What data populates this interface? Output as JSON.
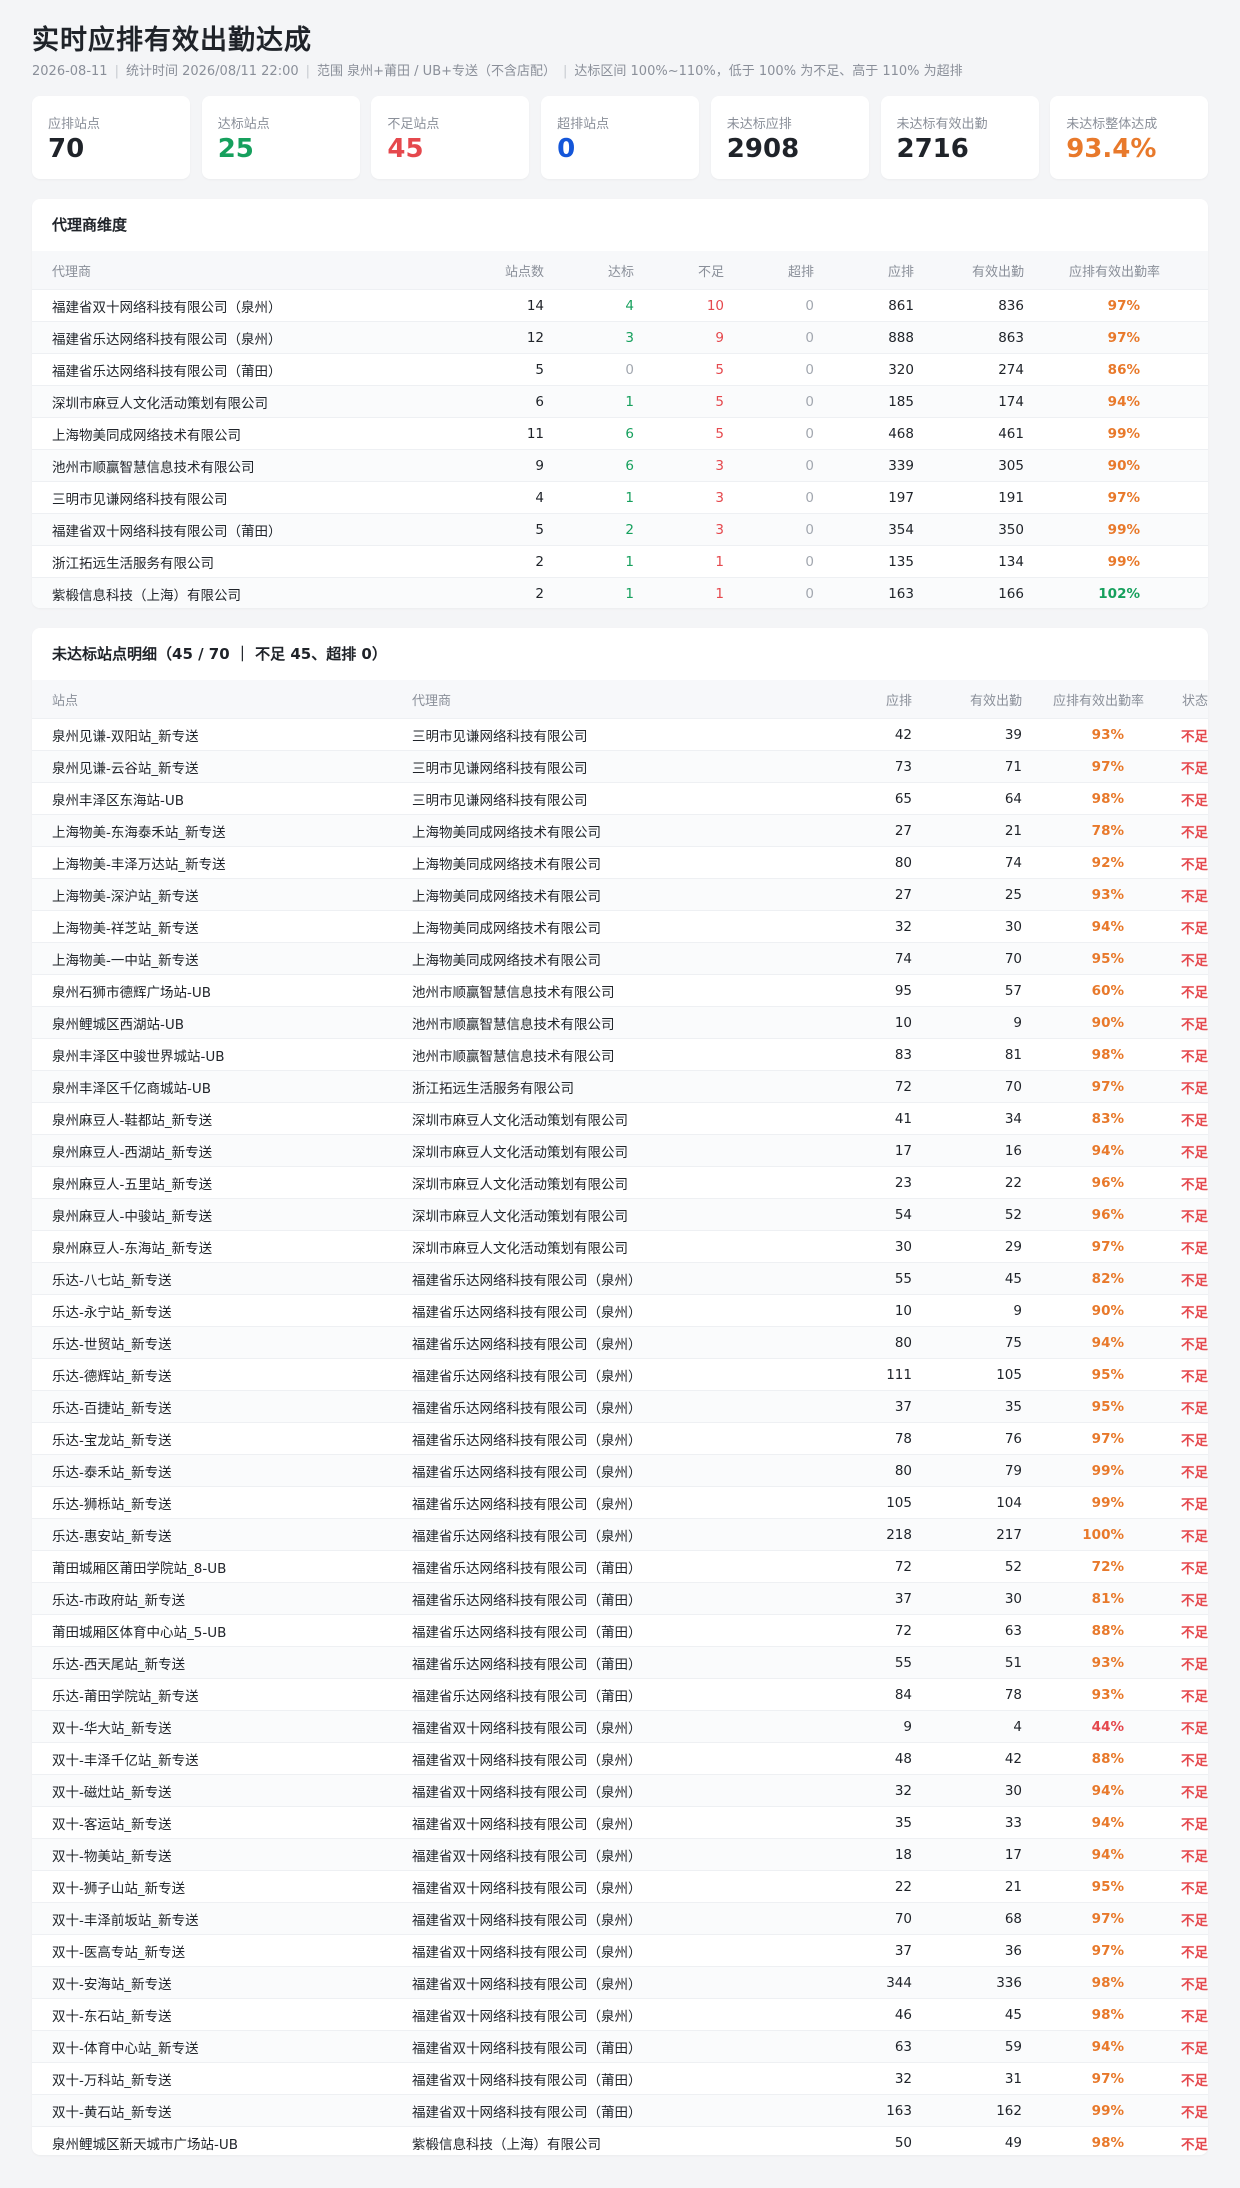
{
  "page": {
    "title": "实时应排有效出勤达成",
    "meta": [
      "2026-08-11",
      "统计时间 2026/08/11 22:00",
      "范围 泉州+莆田 / UB+专送（不含店配）",
      "达标区间 100%~110%，低于 100% 为不足、高于 110% 为超排"
    ]
  },
  "colors": {
    "green": "#16a05d",
    "red": "#e5484d",
    "orange": "#e8792b",
    "blue": "#1456d9",
    "gray": "#a3a8b0"
  },
  "kpis": [
    {
      "label": "应排站点",
      "value": "70",
      "color": "default"
    },
    {
      "label": "达标站点",
      "value": "25",
      "color": "green"
    },
    {
      "label": "不足站点",
      "value": "45",
      "color": "red"
    },
    {
      "label": "超排站点",
      "value": "0",
      "color": "blue"
    },
    {
      "label": "未达标应排",
      "value": "2908",
      "color": "default"
    },
    {
      "label": "未达标有效出勤",
      "value": "2716",
      "color": "default"
    },
    {
      "label": "未达标整体达成",
      "value": "93.4%",
      "color": "orange"
    }
  ],
  "agent_table": {
    "title": "代理商维度",
    "headers": [
      "代理商",
      "站点数",
      "达标",
      "不足",
      "超排",
      "应排",
      "有效出勤",
      "应排有效出勤率"
    ],
    "rows": [
      [
        "福建省双十网络科技有限公司（泉州）",
        "14",
        "4",
        "10",
        "0",
        "861",
        "836",
        "97%"
      ],
      [
        "福建省乐达网络科技有限公司（泉州）",
        "12",
        "3",
        "9",
        "0",
        "888",
        "863",
        "97%"
      ],
      [
        "福建省乐达网络科技有限公司（莆田）",
        "5",
        "0",
        "5",
        "0",
        "320",
        "274",
        "86%"
      ],
      [
        "深圳市麻豆人文化活动策划有限公司",
        "6",
        "1",
        "5",
        "0",
        "185",
        "174",
        "94%"
      ],
      [
        "上海物美同成网络技术有限公司",
        "11",
        "6",
        "5",
        "0",
        "468",
        "461",
        "99%"
      ],
      [
        "池州市顺赢智慧信息技术有限公司",
        "9",
        "6",
        "3",
        "0",
        "339",
        "305",
        "90%"
      ],
      [
        "三明市见谦网络科技有限公司",
        "4",
        "1",
        "3",
        "0",
        "197",
        "191",
        "97%"
      ],
      [
        "福建省双十网络科技有限公司（莆田）",
        "5",
        "2",
        "3",
        "0",
        "354",
        "350",
        "99%"
      ],
      [
        "浙江拓远生活服务有限公司",
        "2",
        "1",
        "1",
        "0",
        "135",
        "134",
        "99%"
      ],
      [
        "紫椴信息科技（上海）有限公司",
        "2",
        "1",
        "1",
        "0",
        "163",
        "166",
        "102%"
      ]
    ]
  },
  "station_table": {
    "title": "未达标站点明细（45 / 70 ｜ 不足 45、超排 0）",
    "headers": [
      "站点",
      "代理商",
      "应排",
      "有效出勤",
      "应排有效出勤率",
      "状态"
    ],
    "rows": [
      [
        "泉州见谦-双阳站_新专送",
        "三明市见谦网络科技有限公司",
        "42",
        "39",
        "93%",
        "不足"
      ],
      [
        "泉州见谦-云谷站_新专送",
        "三明市见谦网络科技有限公司",
        "73",
        "71",
        "97%",
        "不足"
      ],
      [
        "泉州丰泽区东海站-UB",
        "三明市见谦网络科技有限公司",
        "65",
        "64",
        "98%",
        "不足"
      ],
      [
        "上海物美-东海泰禾站_新专送",
        "上海物美同成网络技术有限公司",
        "27",
        "21",
        "78%",
        "不足"
      ],
      [
        "上海物美-丰泽万达站_新专送",
        "上海物美同成网络技术有限公司",
        "80",
        "74",
        "92%",
        "不足"
      ],
      [
        "上海物美-深沪站_新专送",
        "上海物美同成网络技术有限公司",
        "27",
        "25",
        "93%",
        "不足"
      ],
      [
        "上海物美-祥芝站_新专送",
        "上海物美同成网络技术有限公司",
        "32",
        "30",
        "94%",
        "不足"
      ],
      [
        "上海物美-一中站_新专送",
        "上海物美同成网络技术有限公司",
        "74",
        "70",
        "95%",
        "不足"
      ],
      [
        "泉州石狮市德辉广场站-UB",
        "池州市顺赢智慧信息技术有限公司",
        "95",
        "57",
        "60%",
        "不足"
      ],
      [
        "泉州鲤城区西湖站-UB",
        "池州市顺赢智慧信息技术有限公司",
        "10",
        "9",
        "90%",
        "不足"
      ],
      [
        "泉州丰泽区中骏世界城站-UB",
        "池州市顺赢智慧信息技术有限公司",
        "83",
        "81",
        "98%",
        "不足"
      ],
      [
        "泉州丰泽区千亿商城站-UB",
        "浙江拓远生活服务有限公司",
        "72",
        "70",
        "97%",
        "不足"
      ],
      [
        "泉州麻豆人-鞋都站_新专送",
        "深圳市麻豆人文化活动策划有限公司",
        "41",
        "34",
        "83%",
        "不足"
      ],
      [
        "泉州麻豆人-西湖站_新专送",
        "深圳市麻豆人文化活动策划有限公司",
        "17",
        "16",
        "94%",
        "不足"
      ],
      [
        "泉州麻豆人-五里站_新专送",
        "深圳市麻豆人文化活动策划有限公司",
        "23",
        "22",
        "96%",
        "不足"
      ],
      [
        "泉州麻豆人-中骏站_新专送",
        "深圳市麻豆人文化活动策划有限公司",
        "54",
        "52",
        "96%",
        "不足"
      ],
      [
        "泉州麻豆人-东海站_新专送",
        "深圳市麻豆人文化活动策划有限公司",
        "30",
        "29",
        "97%",
        "不足"
      ],
      [
        "乐达-八七站_新专送",
        "福建省乐达网络科技有限公司（泉州）",
        "55",
        "45",
        "82%",
        "不足"
      ],
      [
        "乐达-永宁站_新专送",
        "福建省乐达网络科技有限公司（泉州）",
        "10",
        "9",
        "90%",
        "不足"
      ],
      [
        "乐达-世贸站_新专送",
        "福建省乐达网络科技有限公司（泉州）",
        "80",
        "75",
        "94%",
        "不足"
      ],
      [
        "乐达-德辉站_新专送",
        "福建省乐达网络科技有限公司（泉州）",
        "111",
        "105",
        "95%",
        "不足"
      ],
      [
        "乐达-百捷站_新专送",
        "福建省乐达网络科技有限公司（泉州）",
        "37",
        "35",
        "95%",
        "不足"
      ],
      [
        "乐达-宝龙站_新专送",
        "福建省乐达网络科技有限公司（泉州）",
        "78",
        "76",
        "97%",
        "不足"
      ],
      [
        "乐达-泰禾站_新专送",
        "福建省乐达网络科技有限公司（泉州）",
        "80",
        "79",
        "99%",
        "不足"
      ],
      [
        "乐达-狮栎站_新专送",
        "福建省乐达网络科技有限公司（泉州）",
        "105",
        "104",
        "99%",
        "不足"
      ],
      [
        "乐达-惠安站_新专送",
        "福建省乐达网络科技有限公司（泉州）",
        "218",
        "217",
        "100%",
        "不足"
      ],
      [
        "莆田城厢区莆田学院站_8-UB",
        "福建省乐达网络科技有限公司（莆田）",
        "72",
        "52",
        "72%",
        "不足"
      ],
      [
        "乐达-市政府站_新专送",
        "福建省乐达网络科技有限公司（莆田）",
        "37",
        "30",
        "81%",
        "不足"
      ],
      [
        "莆田城厢区体育中心站_5-UB",
        "福建省乐达网络科技有限公司（莆田）",
        "72",
        "63",
        "88%",
        "不足"
      ],
      [
        "乐达-西天尾站_新专送",
        "福建省乐达网络科技有限公司（莆田）",
        "55",
        "51",
        "93%",
        "不足"
      ],
      [
        "乐达-莆田学院站_新专送",
        "福建省乐达网络科技有限公司（莆田）",
        "84",
        "78",
        "93%",
        "不足"
      ],
      [
        "双十-华大站_新专送",
        "福建省双十网络科技有限公司（泉州）",
        "9",
        "4",
        "44%",
        "不足"
      ],
      [
        "双十-丰泽千亿站_新专送",
        "福建省双十网络科技有限公司（泉州）",
        "48",
        "42",
        "88%",
        "不足"
      ],
      [
        "双十-磁灶站_新专送",
        "福建省双十网络科技有限公司（泉州）",
        "32",
        "30",
        "94%",
        "不足"
      ],
      [
        "双十-客运站_新专送",
        "福建省双十网络科技有限公司（泉州）",
        "35",
        "33",
        "94%",
        "不足"
      ],
      [
        "双十-物美站_新专送",
        "福建省双十网络科技有限公司（泉州）",
        "18",
        "17",
        "94%",
        "不足"
      ],
      [
        "双十-狮子山站_新专送",
        "福建省双十网络科技有限公司（泉州）",
        "22",
        "21",
        "95%",
        "不足"
      ],
      [
        "双十-丰泽前坂站_新专送",
        "福建省双十网络科技有限公司（泉州）",
        "70",
        "68",
        "97%",
        "不足"
      ],
      [
        "双十-医高专站_新专送",
        "福建省双十网络科技有限公司（泉州）",
        "37",
        "36",
        "97%",
        "不足"
      ],
      [
        "双十-安海站_新专送",
        "福建省双十网络科技有限公司（泉州）",
        "344",
        "336",
        "98%",
        "不足"
      ],
      [
        "双十-东石站_新专送",
        "福建省双十网络科技有限公司（泉州）",
        "46",
        "45",
        "98%",
        "不足"
      ],
      [
        "双十-体育中心站_新专送",
        "福建省双十网络科技有限公司（莆田）",
        "63",
        "59",
        "94%",
        "不足"
      ],
      [
        "双十-万科站_新专送",
        "福建省双十网络科技有限公司（莆田）",
        "32",
        "31",
        "97%",
        "不足"
      ],
      [
        "双十-黄石站_新专送",
        "福建省双十网络科技有限公司（莆田）",
        "163",
        "162",
        "99%",
        "不足"
      ],
      [
        "泉州鲤城区新天城市广场站-UB",
        "紫椴信息科技（上海）有限公司",
        "50",
        "49",
        "98%",
        "不足"
      ]
    ]
  }
}
